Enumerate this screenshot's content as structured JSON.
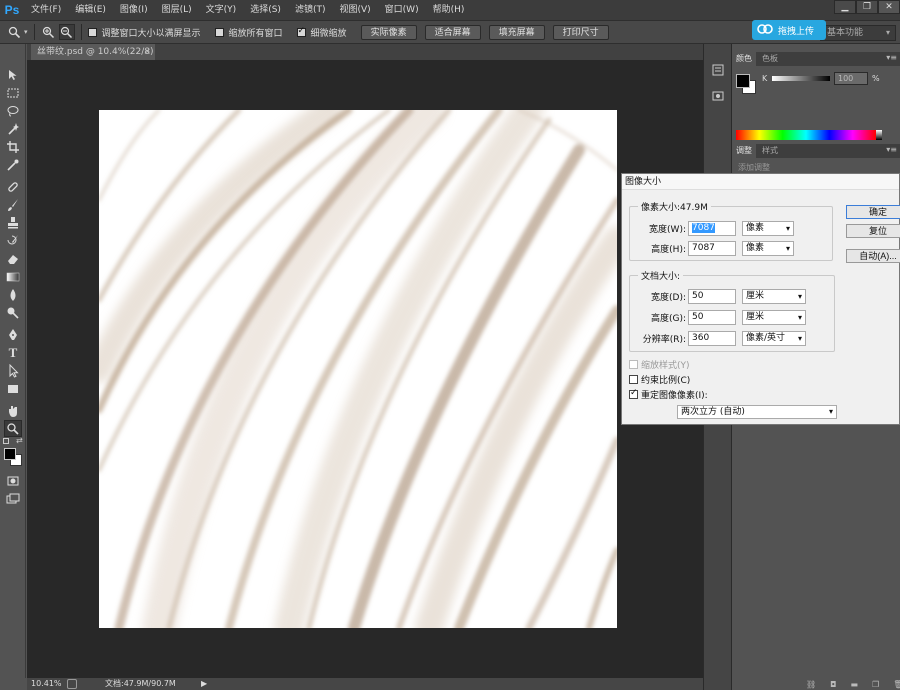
{
  "app": {
    "logo": "Ps"
  },
  "menu": [
    "文件(F)",
    "编辑(E)",
    "图像(I)",
    "图层(L)",
    "文字(Y)",
    "选择(S)",
    "滤镜(T)",
    "视图(V)",
    "窗口(W)",
    "帮助(H)"
  ],
  "upload_button": "拖拽上传",
  "options": {
    "resize_windows": "调整窗口大小以满屏显示",
    "zoom_all": "缩放所有窗口",
    "scrubby_zoom": "细微缩放",
    "actual_pixels": "实际像素",
    "fit_screen": "适合屏幕",
    "fill_screen": "填充屏幕",
    "print_size": "打印尺寸",
    "workspace": "基本功能"
  },
  "document": {
    "tab": "丝带纹.psd @ 10.4%(22/8)",
    "close": "×"
  },
  "status": {
    "zoom": "10.41%",
    "doc_size": "文档:47.9M/90.7M",
    "arrow": "▶"
  },
  "panels": {
    "color_tab": "颜色",
    "swatches_tab": "色板",
    "k_label": "K",
    "k_value": "100",
    "k_unit": "%",
    "adjust_tab": "调整",
    "styles_tab": "样式",
    "adjust_hint": "添加调整"
  },
  "dialog": {
    "title": "图像大小",
    "pixel_dims": "像素大小:47.9M",
    "width_label": "宽度(W):",
    "width_value": "7087",
    "width_unit": "像素",
    "height_label": "高度(H):",
    "height_value": "7087",
    "height_unit": "像素",
    "doc_size_label": "文档大小:",
    "doc_width_label": "宽度(D):",
    "doc_width_value": "50",
    "doc_width_unit": "厘米",
    "doc_height_label": "高度(G):",
    "doc_height_value": "50",
    "doc_height_unit": "厘米",
    "resolution_label": "分辨率(R):",
    "resolution_value": "360",
    "resolution_unit": "像素/英寸",
    "scale_styles": "缩放样式(Y)",
    "constrain": "约束比例(C)",
    "resample": "重定图像像素(I):",
    "resample_method": "两次立方 (自动)",
    "ok": "确定",
    "reset": "复位",
    "auto": "自动(A)..."
  }
}
